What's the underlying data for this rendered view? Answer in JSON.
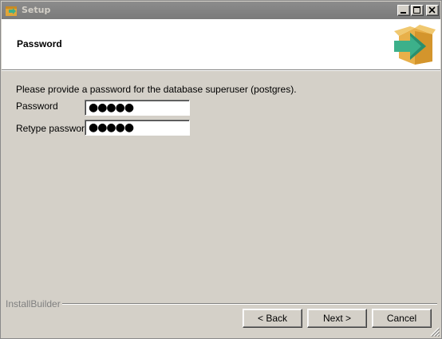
{
  "window": {
    "title": "Setup"
  },
  "header": {
    "title": "Password"
  },
  "form": {
    "instructions": "Please provide a password for the database superuser (postgres).",
    "password_label": "Password",
    "password_value": "●●●●●",
    "retype_label": "Retype password",
    "retype_value": "●●●●●"
  },
  "footer": {
    "brand": "InstallBuilder",
    "back_label": "< Back",
    "next_label": "Next >",
    "cancel_label": "Cancel"
  },
  "icons": {
    "app": "installer-app-icon",
    "header": "box-arrow-icon",
    "minimize": "minimize-icon",
    "maximize": "maximize-icon",
    "close": "close-icon"
  },
  "colors": {
    "titlebar": "#808080",
    "dialog_bg": "#d4d0c8",
    "header_bg": "#ffffff",
    "arrow": "#3cb08a",
    "box": "#e8b04a"
  }
}
